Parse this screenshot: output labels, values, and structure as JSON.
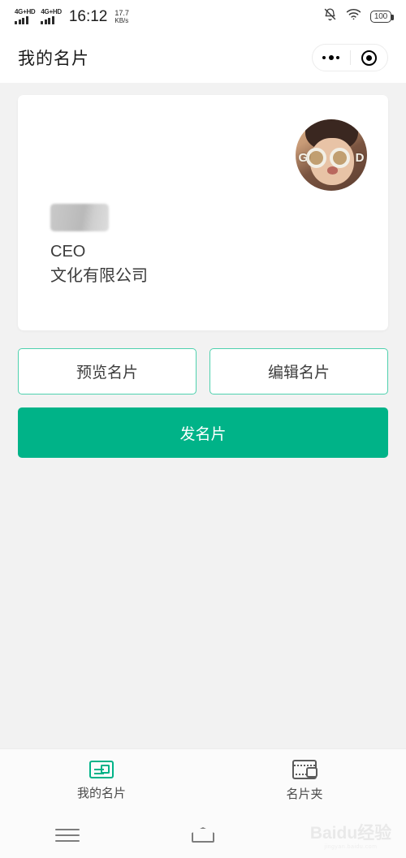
{
  "status_bar": {
    "sim1_network": "4G+HD",
    "sim2_network": "4G+HD",
    "time": "16:12",
    "net_speed_value": "17.7",
    "net_speed_unit": "KB/s",
    "mute_icon": "bell-muted-icon",
    "wifi_icon": "wifi-icon",
    "battery_level": "100"
  },
  "nav_bar": {
    "title": "我的名片",
    "menu_icon": "ellipsis-icon",
    "target_icon": "target-circle-icon"
  },
  "card": {
    "name_redacted": "",
    "job_title": "CEO",
    "company": "文化有限公司",
    "avatar_icon": "avatar-photo",
    "avatar_overlay_left": "G",
    "avatar_overlay_right": "D"
  },
  "actions": {
    "preview_label": "预览名片",
    "edit_label": "编辑名片",
    "send_label": "发名片"
  },
  "tab_bar": {
    "tabs": [
      {
        "label": "我的名片",
        "icon": "business-card-icon",
        "active": true
      },
      {
        "label": "名片夹",
        "icon": "wallet-icon",
        "active": false
      }
    ]
  },
  "android_nav": {
    "menu_icon": "menu-icon",
    "home_icon": "home-icon"
  },
  "watermark": {
    "main": "Baidu经验",
    "sub": "jingyan.baidu.com"
  },
  "colors": {
    "accent_green": "#00b388",
    "outline_green": "#4fd1ae",
    "background": "#f2f2f2",
    "card": "#ffffff"
  }
}
